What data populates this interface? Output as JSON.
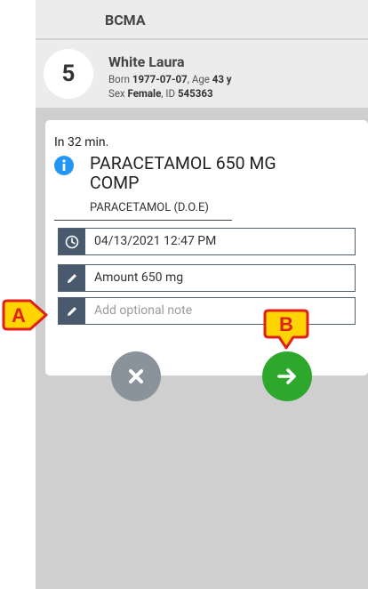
{
  "header": {
    "title": "BCMA"
  },
  "patient": {
    "bed": "5",
    "name": "White Laura",
    "born_label": "Born",
    "born": "1977-07-07",
    "age_label": "Age",
    "age": "43 y",
    "sex_label": "Sex",
    "sex": "Female",
    "id_label": "ID",
    "id": "545363"
  },
  "administration": {
    "time_remaining": "In 32 min.",
    "drug_name": "PARACETAMOL 650 MG COMP",
    "drug_generic": "PARACETAMOL (D.O.E)",
    "datetime": "04/13/2021 12:47 PM",
    "amount": "Amount 650 mg",
    "note_placeholder": "Add optional note"
  },
  "markers": {
    "a": "A",
    "b": "B"
  },
  "colors": {
    "header_bg": "#ececec",
    "field_icon_bg": "#4a5a6e",
    "confirm_green": "#2da82d",
    "cancel_gray": "#8a939b",
    "marker_red": "#e0201c",
    "marker_yellow": "#ffd400",
    "info_blue": "#2196f3"
  },
  "icons": {
    "info": "info-icon",
    "clock": "clock-icon",
    "pencil": "pencil-icon",
    "cancel": "close-icon",
    "confirm": "arrow-right-icon"
  }
}
